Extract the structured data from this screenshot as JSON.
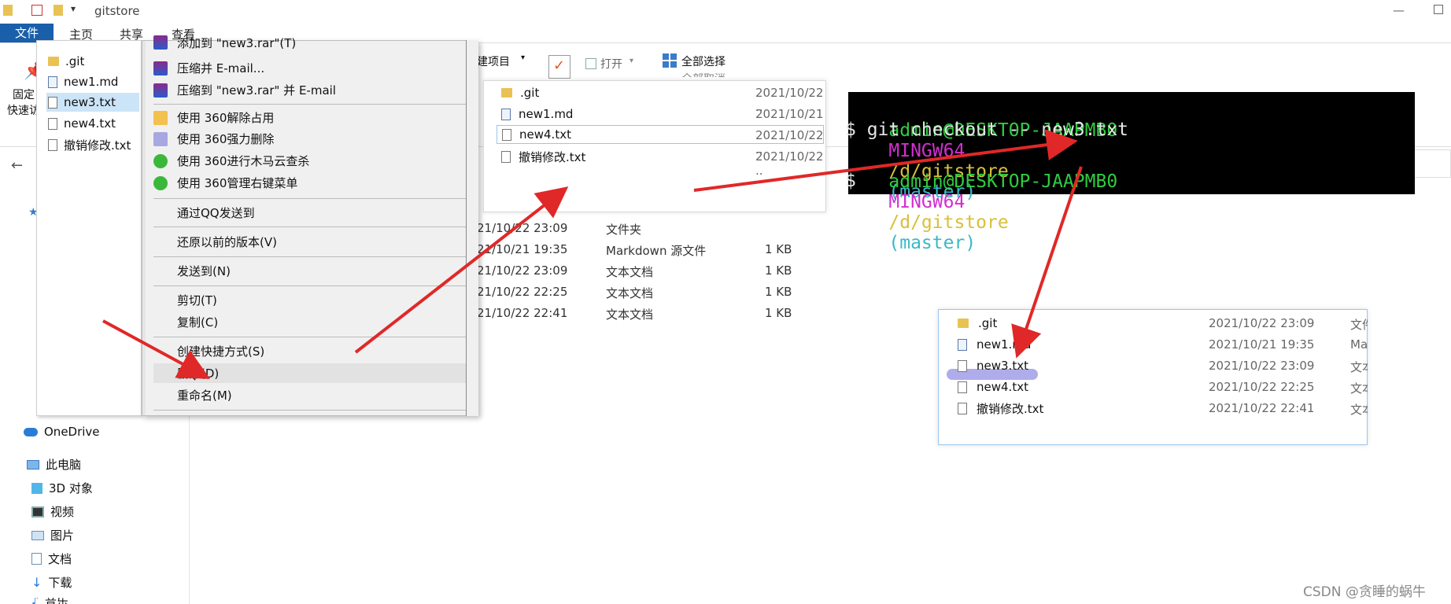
{
  "window": {
    "title": "gitstore"
  },
  "ribbon": {
    "tabs": [
      "文件",
      "主页",
      "共享",
      "查看"
    ],
    "pin_label": "固定",
    "quick_label": "快速访",
    "new_project": "新建项目",
    "open": "打开",
    "select_all": "全部选择",
    "select_none": "全部取消",
    "col_text_1": "文",
    "col_text_2": "文",
    "col_text_3": "文"
  },
  "context_files": [
    {
      "name": ".git",
      "icon": "folder-icon",
      "selected": false
    },
    {
      "name": "new1.md",
      "icon": "md-file-icon",
      "selected": false
    },
    {
      "name": "new3.txt",
      "icon": "text-file-icon",
      "selected": true
    },
    {
      "name": "new4.txt",
      "icon": "text-file-icon",
      "selected": false
    },
    {
      "name": "撤销修改.txt",
      "icon": "text-file-icon",
      "selected": false
    }
  ],
  "context_menu": {
    "add_rar": "添加到 \"new3.rar\"(T)",
    "compress_email": "压缩并 E-mail...",
    "compress_rar_email": "压缩到 \"new3.rar\" 并 E-mail",
    "unlock_360": "使用 360解除占用",
    "force_delete_360": "使用 360强力删除",
    "trojan_scan_360": "使用 360进行木马云查杀",
    "manage_menu_360": "使用 360管理右键菜单",
    "send_qq": "通过QQ发送到",
    "restore_prev": "还原以前的版本(V)",
    "send_to": "发送到(N)",
    "cut": "剪切(T)",
    "copy": "复制(C)",
    "create_shortcut": "创建快捷方式(S)",
    "delete": "删除(D)",
    "rename": "重命名(M)"
  },
  "bg_list": [
    {
      "date": "21/10/22 23:09",
      "type": "文件夹",
      "size": ""
    },
    {
      "date": "21/10/21 19:35",
      "type": "Markdown 源文件",
      "size": "1 KB"
    },
    {
      "date": "21/10/22 23:09",
      "type": "文本文档",
      "size": "1 KB"
    },
    {
      "date": "21/10/22 22:25",
      "type": "文本文档",
      "size": "1 KB"
    },
    {
      "date": "21/10/22 22:41",
      "type": "文本文档",
      "size": "1 KB"
    }
  ],
  "panel_after_delete": [
    {
      "name": ".git",
      "date": "2021/10/22 ..",
      "icon": "folder-icon"
    },
    {
      "name": "new1.md",
      "date": "2021/10/21",
      "icon": "md-file-icon"
    },
    {
      "name": "new4.txt",
      "date": "2021/10/22 ..",
      "icon": "text-file-icon"
    },
    {
      "name": "撤销修改.txt",
      "date": "2021/10/22 ..",
      "icon": "text-file-icon"
    }
  ],
  "terminal": {
    "user_host_1": "admin@DESKTOP-JAAPMB0",
    "env_1": "MINGW64",
    "path_1": "/d/gitstore",
    "branch_1": "(master)",
    "command": "$ git checkout -- new3.txt",
    "user_host_2": "admin@DESKTOP-JAAPMB0",
    "env_2": "MINGW64",
    "path_2": "/d/gitstore",
    "branch_2": "(master)",
    "prompt": "$"
  },
  "panel_restored": [
    {
      "name": ".git",
      "date": "2021/10/22 23:09",
      "type": "文件",
      "icon": "folder-icon"
    },
    {
      "name": "new1.md",
      "date": "2021/10/21 19:35",
      "type": "Ma",
      "icon": "md-file-icon"
    },
    {
      "name": "new3.txt",
      "date": "2021/10/22 23:09",
      "type": "文本",
      "icon": "text-file-icon"
    },
    {
      "name": "new4.txt",
      "date": "2021/10/22 22:25",
      "type": "文本",
      "icon": "text-file-icon"
    },
    {
      "name": "撤销修改.txt",
      "date": "2021/10/22 22:41",
      "type": "文本",
      "icon": "text-file-icon"
    }
  ],
  "sidebar": {
    "onedrive": "OneDrive",
    "this_pc": "此电脑",
    "objects_3d": "3D 对象",
    "videos": "视频",
    "pictures": "图片",
    "documents": "文档",
    "downloads": "下载",
    "music": "音乐"
  },
  "watermark": "CSDN @贪睡的蜗牛",
  "colors": {
    "file_tab": "#1a5faa",
    "selection": "#cce4f7",
    "arrow": "#e02828",
    "term_green": "#2ecc40",
    "term_magenta": "#d22fcf",
    "term_yellow": "#d8c03a",
    "term_cyan": "#3ab8c8",
    "highlight_marker": "#9b97e6"
  }
}
